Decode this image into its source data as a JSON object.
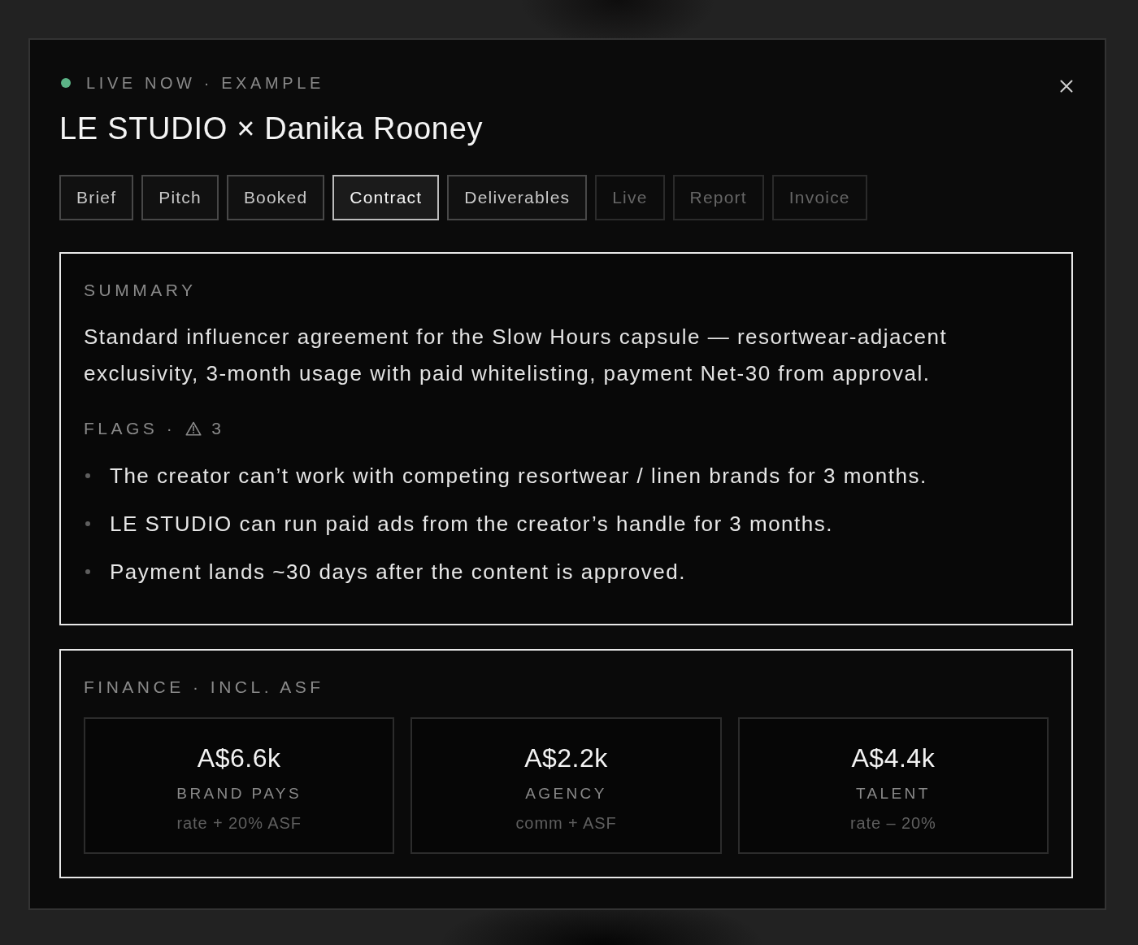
{
  "header": {
    "status": "LIVE NOW · EXAMPLE",
    "title": "LE STUDIO × Danika Rooney"
  },
  "tabs": [
    {
      "label": "Brief",
      "selected": false,
      "disabled": false
    },
    {
      "label": "Pitch",
      "selected": false,
      "disabled": false
    },
    {
      "label": "Booked",
      "selected": false,
      "disabled": false
    },
    {
      "label": "Contract",
      "selected": true,
      "disabled": false
    },
    {
      "label": "Deliverables",
      "selected": false,
      "disabled": false
    },
    {
      "label": "Live",
      "selected": false,
      "disabled": true
    },
    {
      "label": "Report",
      "selected": false,
      "disabled": true
    },
    {
      "label": "Invoice",
      "selected": false,
      "disabled": true
    }
  ],
  "summary": {
    "heading": "SUMMARY",
    "text": "Standard influencer agreement for the Slow Hours capsule — resortwear-adjacent exclusivity, 3-month usage with paid whitelisting, payment Net-30 from approval.",
    "flags_heading": "FLAGS ·",
    "flags_count": "3",
    "flags": [
      "The creator can’t work with competing resortwear / linen brands for 3 months.",
      "LE STUDIO can run paid ads from the creator’s handle for 3 months.",
      "Payment lands ~30 days after the content is approved."
    ]
  },
  "finance": {
    "heading": "FINANCE · INCL. ASF",
    "cards": [
      {
        "value": "A$6.6k",
        "label": "BRAND PAYS",
        "note": "rate + 20% ASF"
      },
      {
        "value": "A$2.2k",
        "label": "AGENCY",
        "note": "comm + ASF"
      },
      {
        "value": "A$4.4k",
        "label": "TALENT",
        "note": "rate – 20%"
      }
    ]
  }
}
